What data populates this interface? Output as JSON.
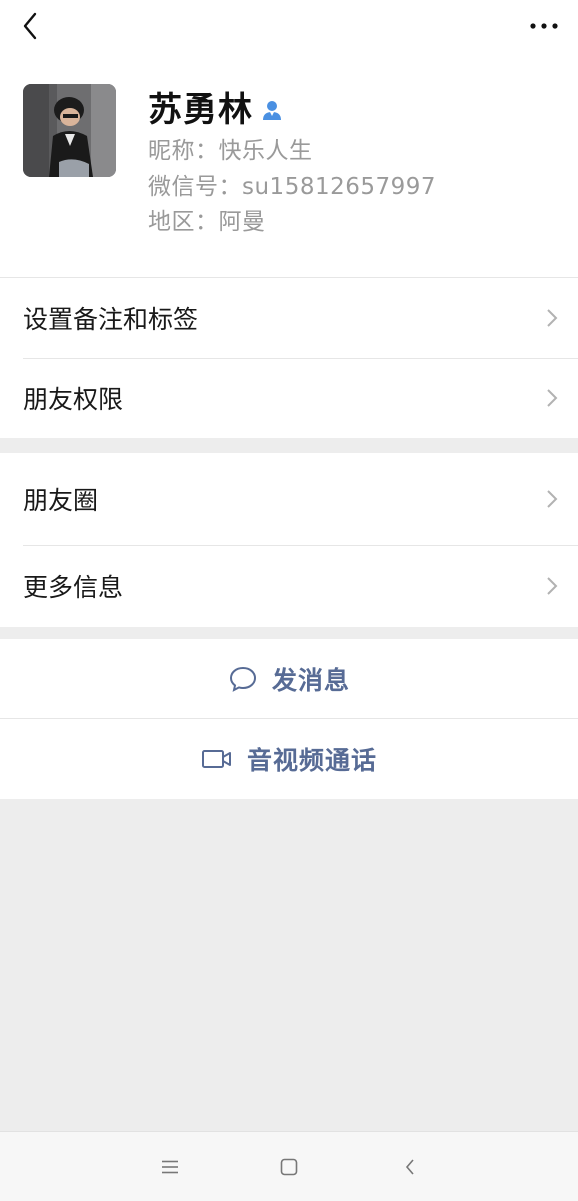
{
  "header": {
    "back_icon": "chevron-left-icon",
    "more_icon": "more-dots-icon"
  },
  "profile": {
    "name": "苏勇林",
    "gender_icon": "person-male-icon",
    "nickname": "昵称：快乐人生",
    "wechat_id": "微信号：su15812657997",
    "region": "地区：阿曼"
  },
  "menu_group_1": [
    {
      "label": "设置备注和标签"
    },
    {
      "label": "朋友权限"
    }
  ],
  "menu_group_2": [
    {
      "label": "朋友圈"
    },
    {
      "label": "更多信息"
    }
  ],
  "actions": {
    "message_label": "发消息",
    "video_call_label": "音视频通话"
  },
  "colors": {
    "link_blue": "#576b95",
    "background": "#ededed",
    "gender_blue": "#4a90e2"
  }
}
